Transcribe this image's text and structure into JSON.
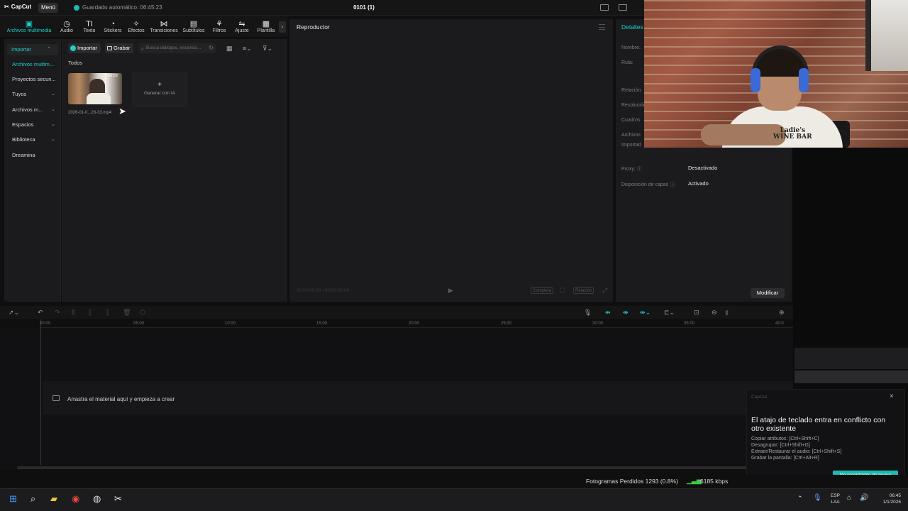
{
  "app": {
    "logo": "CapCut",
    "menu_label": "Menú",
    "autosave": "Guardado automático: 06:45:23",
    "project_title": "0101 (1)"
  },
  "toolbar": {
    "items": [
      {
        "label": "Archivos multimedia",
        "icon": "media-icon",
        "glyph": "▣"
      },
      {
        "label": "Audio",
        "icon": "audio-icon",
        "glyph": "◷"
      },
      {
        "label": "Texto",
        "icon": "text-icon",
        "glyph": "TI"
      },
      {
        "label": "Stickers",
        "icon": "sticker-icon",
        "glyph": "◔"
      },
      {
        "label": "Efectos",
        "icon": "effects-icon",
        "glyph": "✧"
      },
      {
        "label": "Transiciones",
        "icon": "transitions-icon",
        "glyph": "⋈"
      },
      {
        "label": "Subtítulos",
        "icon": "subtitles-icon",
        "glyph": "▤"
      },
      {
        "label": "Filtros",
        "icon": "filters-icon",
        "glyph": "⚘"
      },
      {
        "label": "Ajuste",
        "icon": "adjust-icon",
        "glyph": "⇋"
      },
      {
        "label": "Plantilla",
        "icon": "template-icon",
        "glyph": "▦"
      }
    ],
    "scroll_glyph": "›"
  },
  "sidebar": {
    "items": [
      {
        "label": "Importar",
        "chevron": "⌃"
      },
      {
        "label": "Archivos multim...",
        "chevron": ""
      },
      {
        "label": "Proyectos secun...",
        "chevron": ""
      },
      {
        "label": "Tuyos",
        "chevron": "⌄"
      },
      {
        "label": "Archivos m...",
        "chevron": "⌄"
      },
      {
        "label": "Espacios",
        "chevron": "⌄"
      },
      {
        "label": "Biblioteca",
        "chevron": "⌄"
      },
      {
        "label": "Dreamina",
        "chevron": ""
      }
    ]
  },
  "media": {
    "import_label": "Importar",
    "record_label": "Grabar",
    "search_placeholder": "Busca diálogos, escenas...",
    "filter_label": "Todos",
    "clip_name": "2026-01-0...28-33.mp4",
    "clip_duration": "43:59",
    "gen_ai_label": "Generar con IA",
    "gen_ai_glyph": "+"
  },
  "player": {
    "title": "Reproductor",
    "time": "00:00:00:00 / 00:00:00:00",
    "play_glyph": "▶",
    "ctrl_full": "Completa",
    "ctrl_ratio": "Relación"
  },
  "details": {
    "title": "Detalles",
    "labels": {
      "nombre": "Nombre:",
      "ruta": "Ruta:",
      "relacion": "Relación",
      "resolucion": "Resolución",
      "cuadros": "Cuadros",
      "archivos": "Archivos",
      "importado": "Importad",
      "proxy": "Proxy:",
      "capas": "Disposición de capas"
    },
    "proxy_value": "Desactivado",
    "capas_value": "Activado",
    "modify_label": "Modificar"
  },
  "timeline": {
    "ticks": [
      "00:00",
      "05:00",
      "10:00",
      "15:00",
      "20:00",
      "25:00",
      "30:00",
      "35:00",
      "40:0"
    ],
    "drop_text": "Arrastra el material aquí y empieza a crear"
  },
  "notification": {
    "brand": "CapCut",
    "title": "El atajo de teclado entra en conflicto con otro existente",
    "lines": [
      "Copiar atributos: [Ctrl+Shift+C]",
      "Desagrupar: [Ctrl+Shift+G]",
      "Extraer/Restaurar el audio: [Ctrl+Shift+S]",
      "Grabar la pantalla: [Ctrl+Alt+R]"
    ],
    "button_label": "No recordarme de nuevo",
    "close_glyph": "×"
  },
  "webcam": {
    "shirt_text_1": "Ladie's",
    "shirt_text_2": "WINE BAR"
  },
  "obs": {
    "dropped_frames": "Fotogramas Perdidos 1293 (0.8%)",
    "kbps": "6185 kbps"
  },
  "taskbar": {
    "lang_1": "ESP",
    "lang_2": "LAA",
    "time": "06:45",
    "date": "1/1/2026"
  },
  "colors": {
    "accent": "#1fd0c7",
    "panel": "#1b1b1d",
    "background": "#0f0f10"
  }
}
